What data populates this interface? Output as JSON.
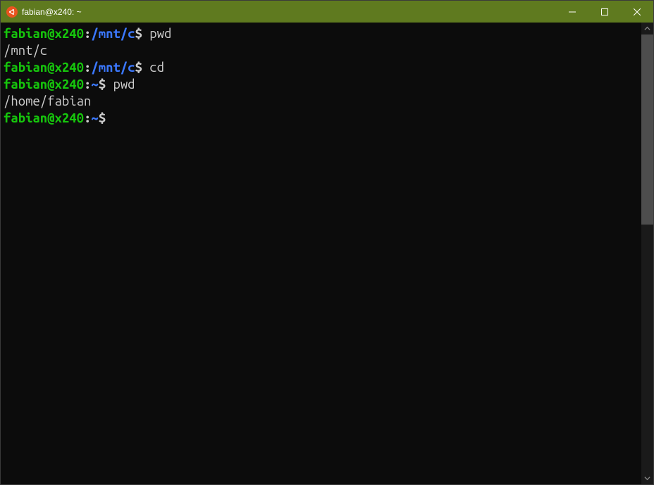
{
  "window": {
    "title": "fabian@x240: ~"
  },
  "colors": {
    "titlebar_bg": "#5f7a1f",
    "terminal_bg": "#0c0c0c",
    "user_host_fg": "#16c60c",
    "path_fg": "#3b78ff",
    "text_fg": "#cccccc",
    "ubuntu_orange": "#e95420"
  },
  "terminal": {
    "lines": [
      {
        "type": "prompt",
        "user_host": "fabian@x240",
        "colon": ":",
        "path": "/mnt/c",
        "dollar": "$ ",
        "command": "pwd"
      },
      {
        "type": "output",
        "text": "/mnt/c"
      },
      {
        "type": "prompt",
        "user_host": "fabian@x240",
        "colon": ":",
        "path": "/mnt/c",
        "dollar": "$ ",
        "command": "cd"
      },
      {
        "type": "prompt",
        "user_host": "fabian@x240",
        "colon": ":",
        "path": "~",
        "dollar": "$ ",
        "command": "pwd"
      },
      {
        "type": "output",
        "text": "/home/fabian"
      },
      {
        "type": "prompt",
        "user_host": "fabian@x240",
        "colon": ":",
        "path": "~",
        "dollar": "$ ",
        "command": ""
      }
    ]
  }
}
